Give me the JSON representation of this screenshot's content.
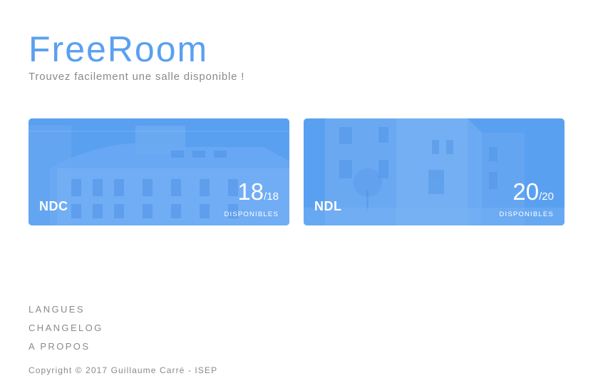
{
  "header": {
    "title": "FreeRoom",
    "subtitle": "Trouvez facilement une salle disponible !"
  },
  "campuses": [
    {
      "name": "NDC",
      "available": "18",
      "total": "/18",
      "label": "DISPONIBLES",
      "available_fraction": 1.0
    },
    {
      "name": "NDL",
      "available": "20",
      "total": "/20",
      "label": "DISPONIBLES",
      "available_fraction": 1.0
    }
  ],
  "footer": {
    "links": [
      "LANGUES",
      "CHANGELOG",
      "A PROPOS"
    ],
    "copyright": "Copyright © 2017 Guillaume Carré - ISEP"
  },
  "colors": {
    "accent": "#5aa0f0",
    "text_muted": "#8a8a8a",
    "background": "#ffffff"
  }
}
